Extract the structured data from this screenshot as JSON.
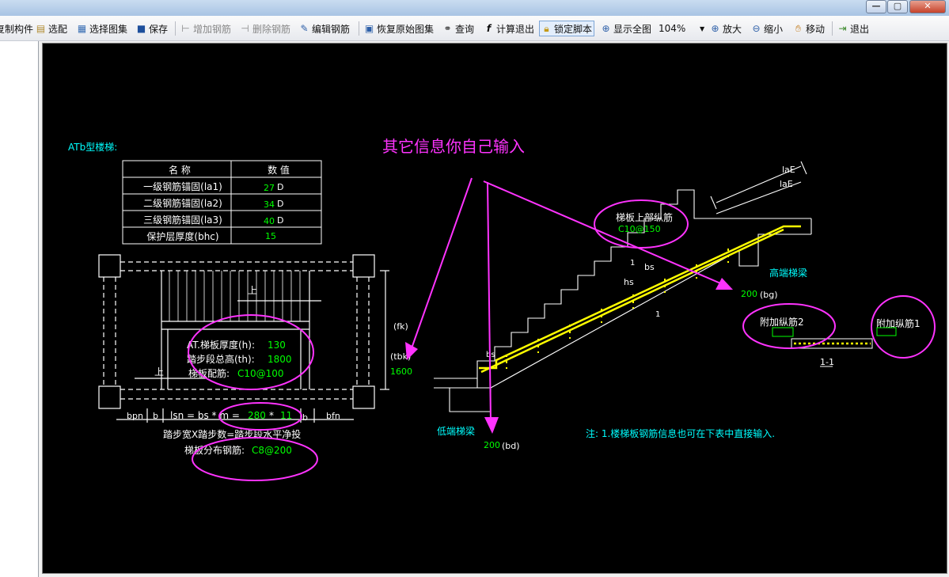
{
  "toolbar": {
    "copy_component": "复制构件",
    "select_config": "选配",
    "select_atlas": "选择图集",
    "save": "保存",
    "add_rebar": "增加钢筋",
    "delete_rebar": "删除钢筋",
    "edit_rebar": "编辑钢筋",
    "restore_atlas": "恢复原始图集",
    "query": "查询",
    "calc_exit": "计算退出",
    "lock_script": "锁定脚本",
    "show_all": "显示全图",
    "zoom_value": "104%",
    "zoom_in": "放大",
    "zoom_out": "缩小",
    "move": "移动",
    "exit": "退出"
  },
  "window_buttons": {
    "minimize": "—",
    "maximize": "▢",
    "close": "✕"
  },
  "drawing": {
    "stair_type": "ATb型楼梯:",
    "annotation": "其它信息你自己输入",
    "table": {
      "headers": [
        "名 称",
        "数 值"
      ],
      "rows": [
        {
          "name": "一级钢筋锚固(la1)",
          "value": "27",
          "unit": "D"
        },
        {
          "name": "二级钢筋锚固(la2)",
          "value": "34",
          "unit": "D"
        },
        {
          "name": "三级钢筋锚固(la3)",
          "value": "40",
          "unit": "D"
        },
        {
          "name": "保护层厚度(bhc)",
          "value": "15",
          "unit": ""
        }
      ]
    },
    "plan": {
      "thickness_label": "AT.梯板厚度(h):",
      "thickness_value": "130",
      "height_label": "踏步段总高(th):",
      "height_value": "1800",
      "rebar_label": "梯板配筋:",
      "rebar_value": "C10@100",
      "up_label_1": "上",
      "up_label_2": "上",
      "fk": "(fk)",
      "tbk": "(tbk)",
      "width_value": "1600",
      "bpn": "bpn",
      "b1": "b",
      "b2": "b",
      "bfn": "bfn",
      "lsn_prefix": "lsn = bs * m =",
      "bs_value": "280",
      "times": "*",
      "m_value": "11",
      "caption": "踏步宽X踏步数=踏步段水平净投",
      "dist_label": "梯板分布钢筋:",
      "dist_value": "C8@200"
    },
    "section": {
      "la_e_1": "laE",
      "la_e_2": "laE",
      "top_rebar_label": "梯板上部纵筋",
      "top_rebar_value": "C10@150",
      "high_beam": "高端梯梁",
      "bg_value": "200",
      "bg_label": "(bg)",
      "low_beam": "低端梯梁",
      "bd_value": "200",
      "bd_label": "(bd)",
      "bs": "bs",
      "hs": "hs",
      "dim_1a": "1",
      "dim_1b": "1",
      "bs_left": "bs",
      "extra_rebar_2": "附加纵筋2",
      "extra_rebar_1": "附加纵筋1",
      "section_label": "1-1",
      "note": "注: 1.楼梯板钢筋信息也可在下表中直接输入."
    }
  },
  "colors": {
    "canvas": "#000000",
    "cyan": "#00ffff",
    "green": "#00ff00",
    "magenta": "#ff33ff",
    "yellow": "#ffff00",
    "white": "#ffffff"
  }
}
